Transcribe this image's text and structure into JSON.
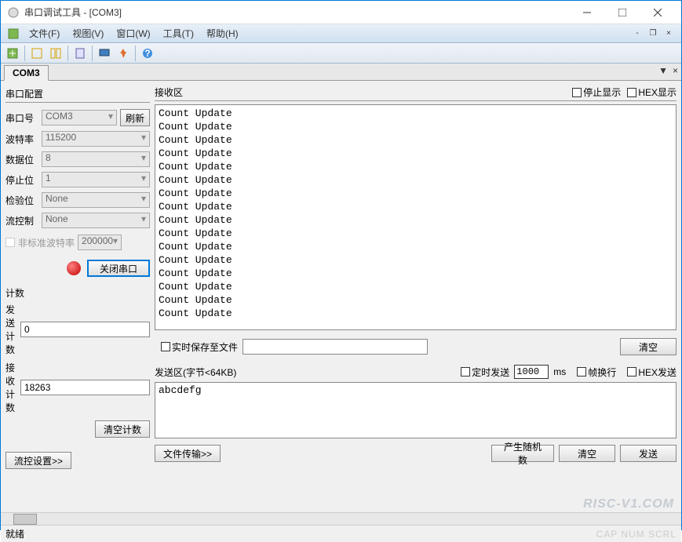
{
  "window": {
    "title": "串口调试工具 - [COM3]"
  },
  "menu": {
    "file": "文件(F)",
    "view": "视图(V)",
    "window": "窗口(W)",
    "tools": "工具(T)",
    "help": "帮助(H)"
  },
  "tab": {
    "label": "COM3"
  },
  "config": {
    "title": "串口配置",
    "port_label": "串口号",
    "port_value": "COM3",
    "refresh": "刷新",
    "baud_label": "波特率",
    "baud_value": "115200",
    "databits_label": "数据位",
    "databits_value": "8",
    "stopbits_label": "停止位",
    "stopbits_value": "1",
    "parity_label": "检验位",
    "parity_value": "None",
    "flow_label": "流控制",
    "flow_value": "None",
    "nonstd_label": "非标准波特率",
    "nonstd_value": "200000",
    "close_port": "关闭串口"
  },
  "counter": {
    "title": "计数",
    "send_label": "发送计数",
    "send_value": "0",
    "recv_label": "接收计数",
    "recv_value": "18263",
    "clear": "清空计数"
  },
  "flow_settings": "流控设置>>",
  "recv": {
    "title": "接收区",
    "stop_display": "停止显示",
    "hex_display": "HEX显示",
    "lines": [
      "Count Update",
      "Count Update",
      "Count Update",
      "Count Update",
      "Count Update",
      "Count Update",
      "Count Update",
      "Count Update",
      "Count Update",
      "Count Update",
      "Count Update",
      "Count Update",
      "Count Update",
      "Count Update",
      "Count Update",
      "Count Update"
    ]
  },
  "save": {
    "realtime_label": "实时保存至文件",
    "clear": "清空"
  },
  "send": {
    "title": "发送区(字节<64KB)",
    "timed_label": "定时发送",
    "timed_value": "1000",
    "timed_unit": "ms",
    "wrap_label": "帧换行",
    "hex_label": "HEX发送",
    "content": "abcdefg",
    "file_transfer": "文件传输>>",
    "random": "产生随机数",
    "clear": "清空",
    "send_btn": "发送"
  },
  "status": {
    "ready": "就绪",
    "indicators": "CAP  NUM  SCRL"
  },
  "watermark": "RISC-V1.COM"
}
